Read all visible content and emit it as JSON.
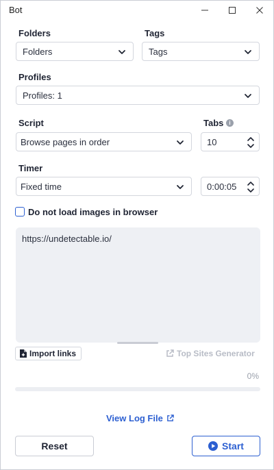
{
  "window": {
    "title": "Bot"
  },
  "folders": {
    "label": "Folders",
    "value": "Folders"
  },
  "tags": {
    "label": "Tags",
    "value": "Tags"
  },
  "profiles": {
    "label": "Profiles",
    "value": "Profiles: 1"
  },
  "script": {
    "label": "Script",
    "value": "Browse pages in order"
  },
  "tabs": {
    "label": "Tabs",
    "value": "10"
  },
  "timer": {
    "label": "Timer",
    "mode": "Fixed time",
    "time": "0:00:05"
  },
  "images_option": {
    "label": "Do not load images in browser",
    "checked": false
  },
  "links": {
    "text": "https://undetectable.io/"
  },
  "import_links": {
    "label": "Import links"
  },
  "top_sites": {
    "label": "Top Sites Generator"
  },
  "progress": {
    "percent_label": "0%",
    "fraction": 0
  },
  "log": {
    "label": "View Log File"
  },
  "actions": {
    "reset_label": "Reset",
    "start_label": "Start"
  },
  "colors": {
    "accent": "#2c5fd1",
    "disabled": "#b8bcc6",
    "textarea_bg": "#eef0f4"
  }
}
